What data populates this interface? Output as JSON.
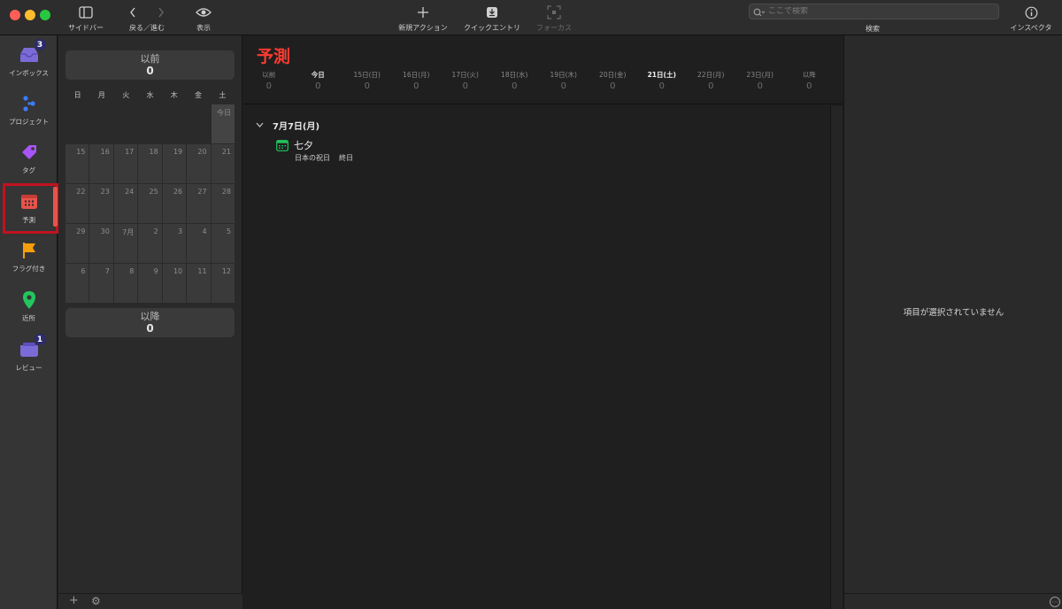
{
  "toolbar": {
    "sidebar": "サイドバー",
    "back_forward": "戻る／進む",
    "view": "表示",
    "new_action": "新規アクション",
    "quick_entry": "クイックエントリ",
    "focus": "フォーカス",
    "search_placeholder": "ここで検索",
    "search": "検索",
    "inspector": "インスペクタ"
  },
  "nav": {
    "items": [
      {
        "label": "インボックス",
        "badge": "3",
        "icon": "inbox-icon",
        "color": "#7b6bd6"
      },
      {
        "label": "プロジェクト",
        "badge": "",
        "icon": "projects-icon",
        "color": "#3b7cff"
      },
      {
        "label": "タグ",
        "badge": "",
        "icon": "tag-icon",
        "color": "#a855f7"
      },
      {
        "label": "予測",
        "badge": "",
        "icon": "forecast-icon",
        "color": "#e8534a"
      },
      {
        "label": "フラグ付き",
        "badge": "",
        "icon": "flag-icon",
        "color": "#f59e0b"
      },
      {
        "label": "近所",
        "badge": "",
        "icon": "location-pin-icon",
        "color": "#22c55e"
      },
      {
        "label": "レビュー",
        "badge": "1",
        "icon": "review-icon",
        "color": "#7b6bd6"
      }
    ]
  },
  "calendar": {
    "past": {
      "title": "以前",
      "count": "0"
    },
    "future": {
      "title": "以降",
      "count": "0"
    },
    "weekdays": [
      "日",
      "月",
      "火",
      "水",
      "木",
      "金",
      "土"
    ],
    "today_label": "今日",
    "weeks": [
      [
        "",
        "",
        "",
        "",
        "",
        "",
        "今日"
      ],
      [
        "15",
        "16",
        "17",
        "18",
        "19",
        "20",
        "21"
      ],
      [
        "22",
        "23",
        "24",
        "25",
        "26",
        "27",
        "28"
      ],
      [
        "29",
        "30",
        "7月",
        "2",
        "3",
        "4",
        "5"
      ],
      [
        "6",
        "7",
        "8",
        "9",
        "10",
        "11",
        "12"
      ]
    ]
  },
  "main": {
    "title": "予測",
    "forecast": [
      {
        "label": "以前",
        "count": "0"
      },
      {
        "label": "今日",
        "count": "0"
      },
      {
        "label": "15日(日)",
        "count": "0"
      },
      {
        "label": "16日(月)",
        "count": "0"
      },
      {
        "label": "17日(火)",
        "count": "0"
      },
      {
        "label": "18日(水)",
        "count": "0"
      },
      {
        "label": "19日(木)",
        "count": "0"
      },
      {
        "label": "20日(金)",
        "count": "0"
      },
      {
        "label": "21日(土)",
        "count": "0"
      },
      {
        "label": "22日(月)",
        "count": "0"
      },
      {
        "label": "23日(月)",
        "count": "0"
      },
      {
        "label": "以降",
        "count": "0"
      }
    ],
    "section_title": "7月7日(月)",
    "event": {
      "name": "七夕",
      "calendar": "日本の祝日",
      "time": "終日",
      "icon_color": "#22c55e"
    }
  },
  "inspector": {
    "empty": "項目が選択されていません"
  }
}
